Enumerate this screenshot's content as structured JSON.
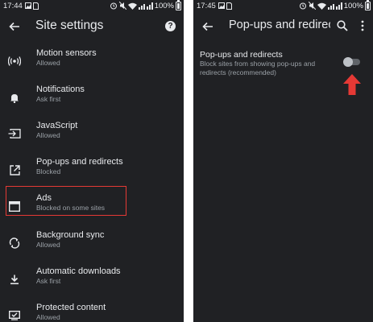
{
  "left_screen": {
    "status": {
      "time": "17:44",
      "battery": "100%"
    },
    "appbar": {
      "title": "Site settings"
    },
    "items": [
      {
        "label": "Motion sensors",
        "sub": "Allowed",
        "icon": "motion-sensors-icon"
      },
      {
        "label": "Notifications",
        "sub": "Ask first",
        "icon": "bell-icon"
      },
      {
        "label": "JavaScript",
        "sub": "Allowed",
        "icon": "javascript-icon"
      },
      {
        "label": "Pop-ups and redirects",
        "sub": "Blocked",
        "icon": "open-in-new-icon"
      },
      {
        "label": "Ads",
        "sub": "Blocked on some sites",
        "icon": "ads-window-icon"
      },
      {
        "label": "Background sync",
        "sub": "Allowed",
        "icon": "sync-icon"
      },
      {
        "label": "Automatic downloads",
        "sub": "Ask first",
        "icon": "download-icon"
      },
      {
        "label": "Protected content",
        "sub": "Allowed",
        "icon": "protected-content-icon"
      }
    ],
    "highlight_color": "#e53935"
  },
  "right_screen": {
    "status": {
      "time": "17:45",
      "battery": "100%"
    },
    "appbar": {
      "title": "Pop-ups and redirects"
    },
    "setting": {
      "label": "Pop-ups and redirects",
      "description": "Block sites from showing pop-ups and redirects (recommended)",
      "enabled": false
    },
    "arrow_color": "#e53935"
  },
  "colors": {
    "background": "#202124",
    "text_primary": "#e8eaed",
    "text_secondary": "#9aa0a6"
  }
}
